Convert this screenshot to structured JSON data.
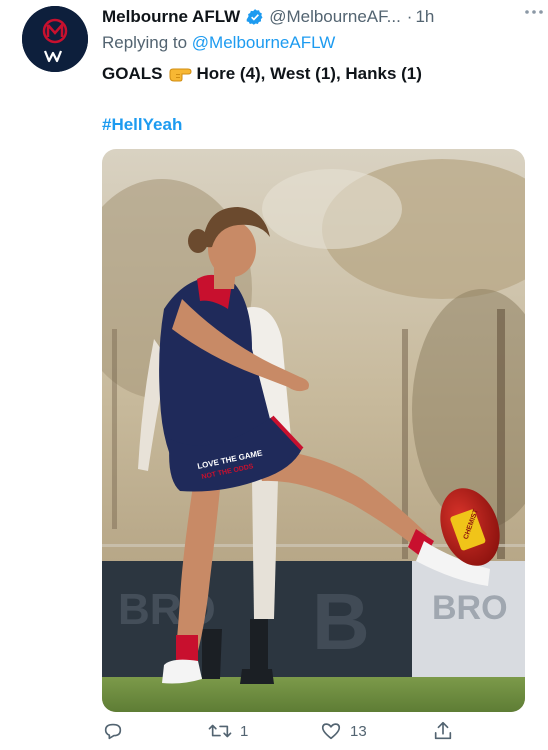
{
  "tweet": {
    "author_name": "Melbourne AFLW",
    "author_handle": "@MelbourneAF...",
    "separator": "·",
    "time": "1h",
    "replying_to_label": "Replying to",
    "replying_to_handle": "@MelbourneAFLW",
    "text_prefix": "GOALS",
    "text_suffix": "Hore (4), West (1), Hanks (1)",
    "hashtag": "#HellYeah"
  },
  "media": {
    "shorts_text_line1": "LOVE THE GAME",
    "shorts_text_line2": "NOT THE ODDS",
    "ball_sponsor": "CHEMIST"
  },
  "actions": {
    "retweets": "1",
    "likes": "13"
  },
  "icons": {
    "verified": "verified-badge-icon",
    "pointer": "pointing-right-emoji-icon",
    "reply": "reply-icon",
    "retweet": "retweet-icon",
    "like": "heart-icon",
    "share": "share-icon",
    "more": "more-icon"
  },
  "colors": {
    "link": "#1d9bf0",
    "secondary_text": "#536471",
    "club_navy": "#0d1f3c",
    "club_red": "#c8102e"
  }
}
